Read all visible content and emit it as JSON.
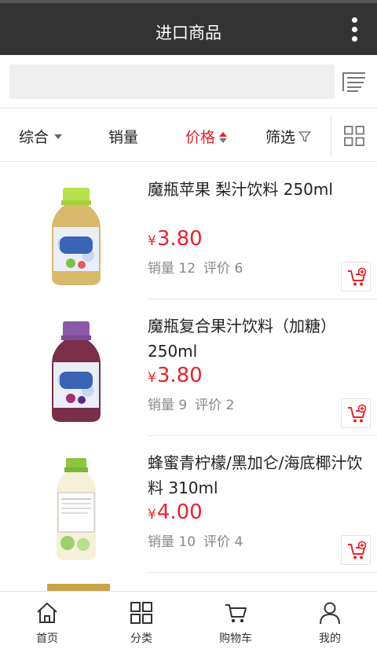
{
  "header": {
    "title": "进口商品"
  },
  "search": {
    "value": ""
  },
  "sortbar": {
    "comprehensive": "综合",
    "sales": "销量",
    "price": "价格",
    "filter": "筛选"
  },
  "colors": {
    "accent": "#e8222a",
    "header_bg": "#333333"
  },
  "products": [
    {
      "title": "魔瓶苹果 梨汁饮料 250ml",
      "price": "3.80",
      "currency": "¥",
      "sales": "销量 12",
      "reviews": "评价 6"
    },
    {
      "title": "魔瓶复合果汁饮料（加糖）250ml",
      "price": "3.80",
      "currency": "¥",
      "sales": "销量 9",
      "reviews": "评价 2"
    },
    {
      "title": "蜂蜜青柠檬/黑加仑/海底椰汁饮料 310ml",
      "price": "4.00",
      "currency": "¥",
      "sales": "销量 10",
      "reviews": "评价 4"
    }
  ],
  "bottom_nav": [
    {
      "label": "首页",
      "icon": "home-icon"
    },
    {
      "label": "分类",
      "icon": "category-icon"
    },
    {
      "label": "购物车",
      "icon": "cart-icon"
    },
    {
      "label": "我的",
      "icon": "user-icon"
    }
  ]
}
